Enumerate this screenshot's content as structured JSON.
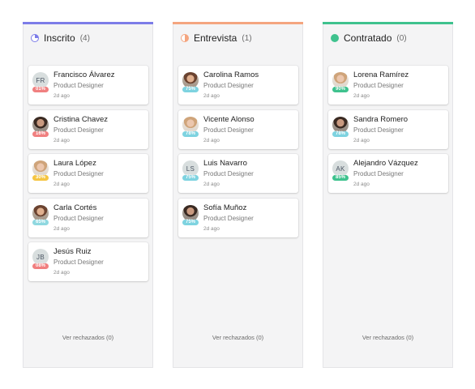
{
  "columns": [
    {
      "title": "Inscrito",
      "count": "(4)",
      "color": "#7c7ce8",
      "icon": "progress-quarter-icon",
      "rejected_label": "Ver rechazados (0)",
      "candidates": [
        {
          "name": "Francisco Álvarez",
          "role": "Product Designer",
          "time": "2d ago",
          "score": "01%",
          "score_color": "#f08080",
          "initials": "FR",
          "photo": ""
        },
        {
          "name": "Cristina Chavez",
          "role": "Product Designer",
          "time": "2d ago",
          "score": "16%",
          "score_color": "#f08080",
          "initials": "",
          "photo": "dark"
        },
        {
          "name": "Laura López",
          "role": "Product Designer",
          "time": "2d ago",
          "score": "30%",
          "score_color": "#f5c542",
          "initials": "",
          "photo": "light"
        },
        {
          "name": "Carla Cortés",
          "role": "Product Designer",
          "time": "2d ago",
          "score": "65%",
          "score_color": "#8fd8e0",
          "initials": "",
          "photo": "warm"
        },
        {
          "name": "Jesús Ruiz",
          "role": "Product Designer",
          "time": "2d ago",
          "score": "08%",
          "score_color": "#f08080",
          "initials": "JB",
          "photo": ""
        }
      ]
    },
    {
      "title": "Entrevista",
      "count": "(1)",
      "color": "#f4a57f",
      "icon": "progress-half-icon",
      "rejected_label": "Ver rechazados (0)",
      "candidates": [
        {
          "name": "Carolina Ramos",
          "role": "Product Designer",
          "time": "2d ago",
          "score": "75%",
          "score_color": "#7ed3e0",
          "initials": "",
          "photo": "warm"
        },
        {
          "name": "Vicente Alonso",
          "role": "Product Designer",
          "time": "2d ago",
          "score": "78%",
          "score_color": "#7ed3e0",
          "initials": "",
          "photo": "light"
        },
        {
          "name": "Luis Navarro",
          "role": "Product Designer",
          "time": "2d ago",
          "score": "75%",
          "score_color": "#7ed3e0",
          "initials": "LS",
          "photo": ""
        },
        {
          "name": "Sofía Muñoz",
          "role": "Product Designer",
          "time": "2d ago",
          "score": "75%",
          "score_color": "#7ed3e0",
          "initials": "",
          "photo": "dark"
        }
      ]
    },
    {
      "title": "Contratado",
      "count": "(0)",
      "color": "#3fc28e",
      "icon": "progress-full-icon",
      "rejected_label": "Ver rechazados (0)",
      "candidates": [
        {
          "name": "Lorena Ramírez",
          "role": "Product Designer",
          "time": "2d ago",
          "score": "90%",
          "score_color": "#3fc28e",
          "initials": "",
          "photo": "light"
        },
        {
          "name": "Sandra Romero",
          "role": "Product Designer",
          "time": "2d ago",
          "score": "78%",
          "score_color": "#7ed3e0",
          "initials": "",
          "photo": "dark"
        },
        {
          "name": "Alejandro Vázquez",
          "role": "Product Designer",
          "time": "2d ago",
          "score": "85%",
          "score_color": "#3fc28e",
          "initials": "AK",
          "photo": ""
        }
      ]
    }
  ]
}
